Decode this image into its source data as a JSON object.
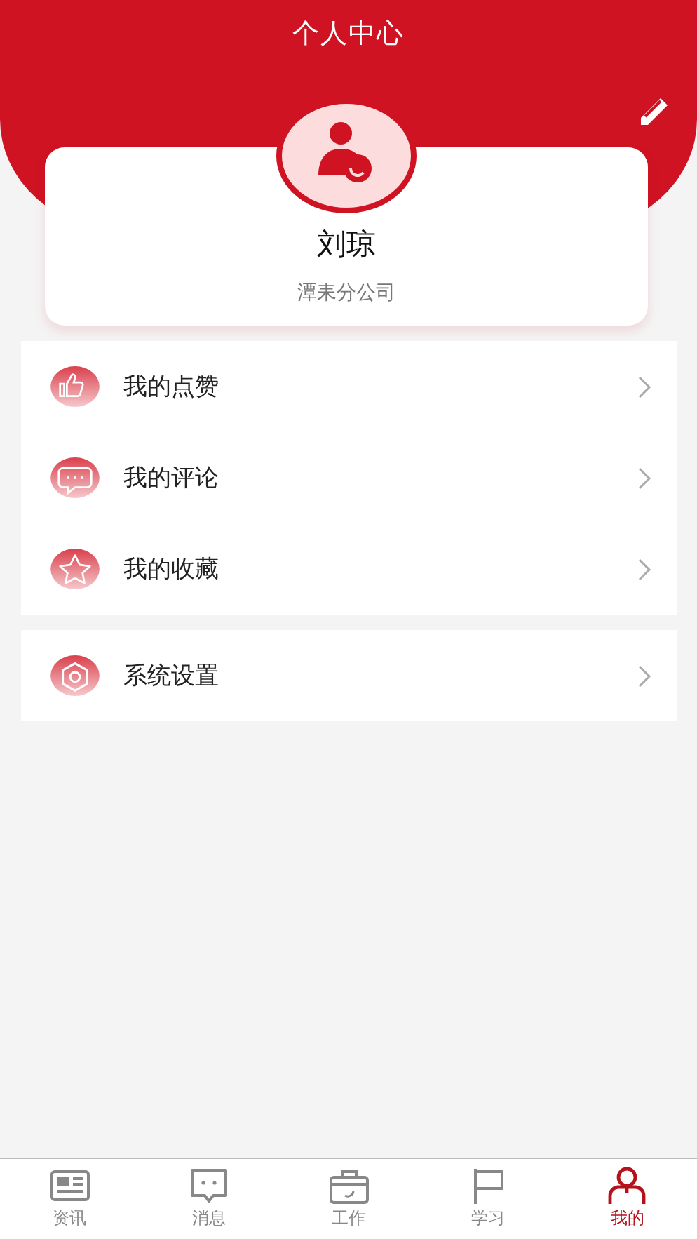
{
  "header": {
    "title": "个人中心"
  },
  "profile": {
    "name": "刘琼",
    "organization": "潭耒分公司"
  },
  "menu_groups": [
    {
      "items": [
        {
          "kind": "like",
          "label": "我的点赞"
        },
        {
          "kind": "comment",
          "label": "我的评论"
        },
        {
          "kind": "favorite",
          "label": "我的收藏"
        }
      ]
    },
    {
      "items": [
        {
          "kind": "settings",
          "label": "系统设置"
        }
      ]
    }
  ],
  "tab_bar": [
    {
      "kind": "news",
      "label": "资讯",
      "selected": false
    },
    {
      "kind": "message",
      "label": "消息",
      "selected": false
    },
    {
      "kind": "work",
      "label": "工作",
      "selected": false
    },
    {
      "kind": "study",
      "label": "学习",
      "selected": false
    },
    {
      "kind": "mine",
      "label": "我的",
      "selected": true
    }
  ]
}
